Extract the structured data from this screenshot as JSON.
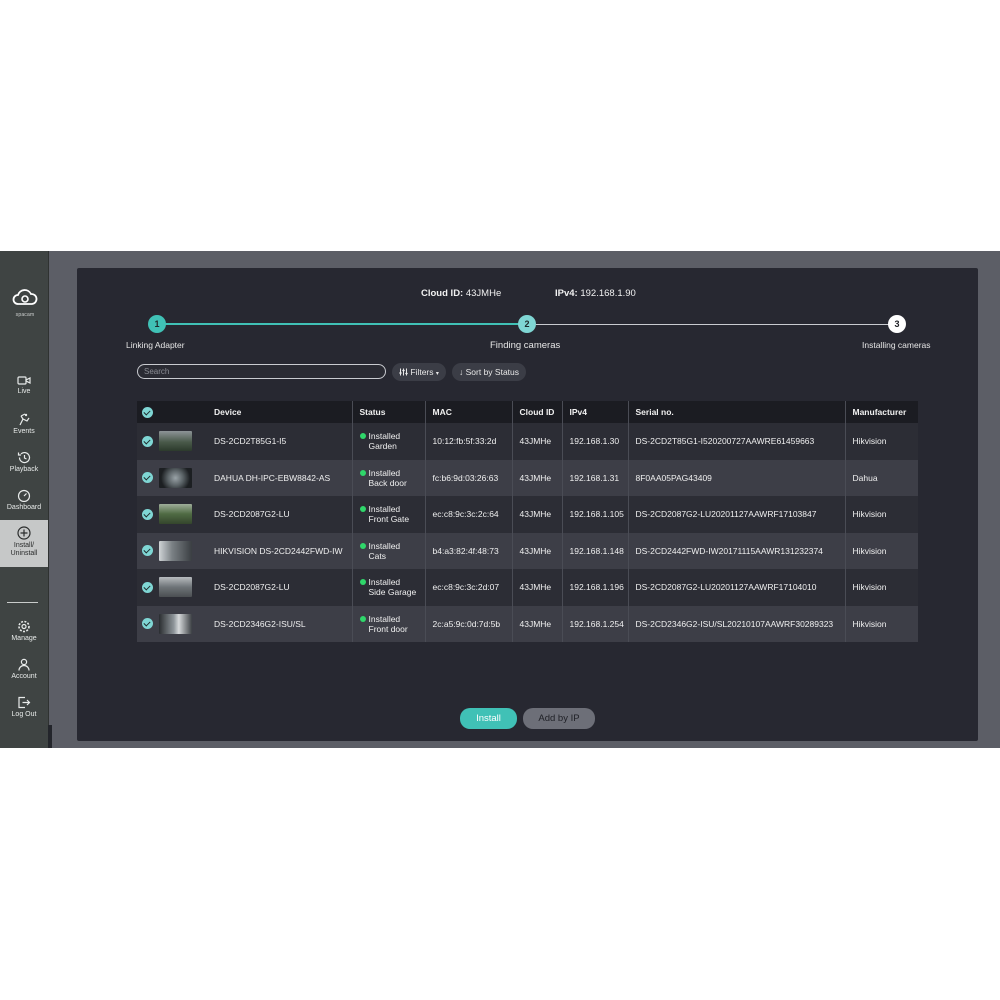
{
  "sidebar": {
    "logo_text": "spacam",
    "items": [
      {
        "label": "Live",
        "icon": "video-icon"
      },
      {
        "label": "Events",
        "icon": "events-icon"
      },
      {
        "label": "Playback",
        "icon": "history-icon"
      },
      {
        "label": "Dashboard",
        "icon": "gauge-icon"
      },
      {
        "label_line1": "Install/",
        "label_line2": "Uninstall",
        "icon": "plus-circle-icon",
        "active": true
      },
      {
        "label": "Manage",
        "icon": "gear-icon"
      },
      {
        "label": "Account",
        "icon": "user-icon"
      },
      {
        "label": "Log Out",
        "icon": "logout-icon"
      }
    ]
  },
  "header": {
    "cloud_label": "Cloud ID:",
    "cloud_value": "43JMHe",
    "ip_label": "IPv4:",
    "ip_value": "192.168.1.90"
  },
  "steps": [
    {
      "number": "1",
      "label": "Linking Adapter"
    },
    {
      "number": "2",
      "label": "Finding cameras"
    },
    {
      "number": "3",
      "label": "Installing cameras"
    }
  ],
  "toolbar": {
    "search_placeholder": "Search",
    "filters_label": "Filters",
    "sort_label": "Sort by Status"
  },
  "table": {
    "columns": [
      "Device",
      "Status",
      "MAC",
      "Cloud ID",
      "IPv4",
      "Serial no.",
      "Manufacturer"
    ],
    "rows": [
      {
        "device": "DS-2CD2T85G1-I5",
        "status": "Installed",
        "location": "Garden",
        "mac": "10:12:fb:5f:33:2d",
        "cloud_id": "43JMHe",
        "ipv4": "192.168.1.30",
        "serial": "DS-2CD2T85G1-I520200727AAWRE61459663",
        "manufacturer": "Hikvision"
      },
      {
        "device": "DAHUA DH-IPC-EBW8842-AS",
        "status": "Installed",
        "location": "Back door",
        "mac": "fc:b6:9d:03:26:63",
        "cloud_id": "43JMHe",
        "ipv4": "192.168.1.31",
        "serial": "8F0AA05PAG43409",
        "manufacturer": "Dahua"
      },
      {
        "device": "DS-2CD2087G2-LU",
        "status": "Installed",
        "location": "Front Gate",
        "mac": "ec:c8:9c:3c:2c:64",
        "cloud_id": "43JMHe",
        "ipv4": "192.168.1.105",
        "serial": "DS-2CD2087G2-LU20201127AAWRF17103847",
        "manufacturer": "Hikvision"
      },
      {
        "device": "HIKVISION DS-2CD2442FWD-IW",
        "status": "Installed",
        "location": "Cats",
        "mac": "b4:a3:82:4f:48:73",
        "cloud_id": "43JMHe",
        "ipv4": "192.168.1.148",
        "serial": "DS-2CD2442FWD-IW20171115AAWR131232374",
        "manufacturer": "Hikvision"
      },
      {
        "device": "DS-2CD2087G2-LU",
        "status": "Installed",
        "location": "Side Garage",
        "mac": "ec:c8:9c:3c:2d:07",
        "cloud_id": "43JMHe",
        "ipv4": "192.168.1.196",
        "serial": "DS-2CD2087G2-LU20201127AAWRF17104010",
        "manufacturer": "Hikvision"
      },
      {
        "device": "DS-2CD2346G2-ISU/SL",
        "status": "Installed",
        "location": "Front door",
        "mac": "2c:a5:9c:0d:7d:5b",
        "cloud_id": "43JMHe",
        "ipv4": "192.168.1.254",
        "serial": "DS-2CD2346G2-ISU/SL20210107AAWRF30289323",
        "manufacturer": "Hikvision"
      }
    ]
  },
  "actions": {
    "install_label": "Install",
    "add_by_ip_label": "Add by IP"
  },
  "colors": {
    "accent": "#40c1b6",
    "panel_bg": "#272831",
    "sidebar_bg": "#3f4443",
    "status_green": "#2fd66a"
  }
}
